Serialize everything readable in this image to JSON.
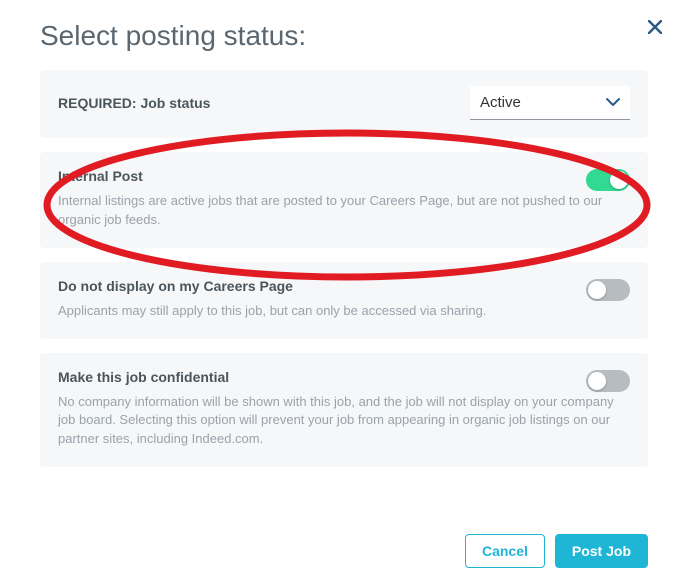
{
  "modal": {
    "title": "Select posting status:"
  },
  "required": {
    "label": "REQUIRED: Job status",
    "selected": "Active"
  },
  "options": [
    {
      "id": "internal-post",
      "title": "Internal Post",
      "desc": "Internal listings are active jobs that are posted to your Careers Page, but are not pushed to our organic job feeds.",
      "on": true
    },
    {
      "id": "no-careers-display",
      "title": "Do not display on my Careers Page",
      "desc": "Applicants may still apply to this job, but can only be accessed via sharing.",
      "on": false
    },
    {
      "id": "confidential",
      "title": "Make this job confidential",
      "desc": "No company information will be shown with this job, and the job will not display on your company job board. Selecting this option will prevent your job from appearing in organic job listings on our partner sites, including Indeed.com.",
      "on": false
    }
  ],
  "footer": {
    "cancel": "Cancel",
    "post": "Post Job"
  },
  "annotation": {
    "kind": "ellipse-highlight",
    "target_option_id": "internal-post",
    "stroke_color": "#e11b22"
  }
}
